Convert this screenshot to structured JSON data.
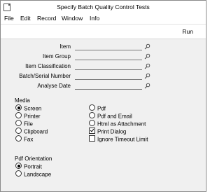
{
  "window": {
    "title": "Specify Batch Quality Control Tests"
  },
  "menu": [
    "File",
    "Edit",
    "Record",
    "Window",
    "Info"
  ],
  "toolbar": {
    "run_label": "Run"
  },
  "fields": [
    {
      "label": "Item",
      "value": ""
    },
    {
      "label": "Item Group",
      "value": ""
    },
    {
      "label": "Item Classification",
      "value": ""
    },
    {
      "label": "Batch/Serial Number",
      "value": ""
    },
    {
      "label": "Analyse Date",
      "value": ""
    }
  ],
  "media": {
    "title": "Media",
    "options_left": [
      {
        "label": "Screen",
        "selected": true
      },
      {
        "label": "Printer",
        "selected": false
      },
      {
        "label": "File",
        "selected": false
      },
      {
        "label": "Clipboard",
        "selected": false
      },
      {
        "label": "Fax",
        "selected": false
      }
    ],
    "options_right": [
      {
        "label": "Pdf",
        "selected": false
      },
      {
        "label": "Pdf and Email",
        "selected": false
      },
      {
        "label": "Html as Attachment",
        "selected": false
      }
    ],
    "checkboxes": [
      {
        "label": "Print Dialog",
        "checked": true
      },
      {
        "label": "Ignore Timeout Limit",
        "checked": false
      }
    ]
  },
  "orientation": {
    "title": "Pdf Orientation",
    "options": [
      {
        "label": "Portrait",
        "selected": true
      },
      {
        "label": "Landscape",
        "selected": false
      }
    ]
  }
}
